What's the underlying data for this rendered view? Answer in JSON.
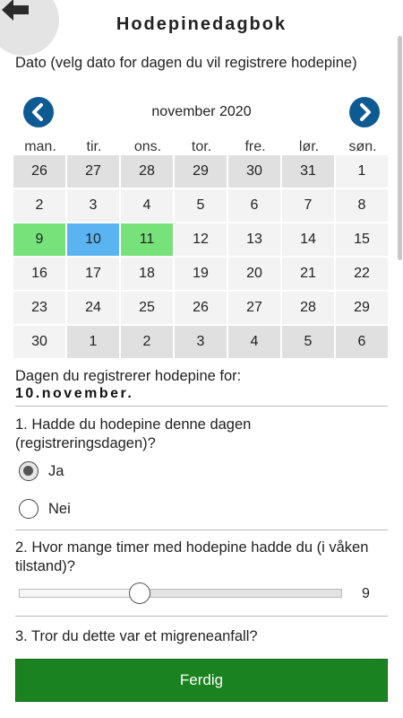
{
  "header": {
    "title": "Hodepinedagbok",
    "back_icon": "arrow-left-icon"
  },
  "date_section": {
    "label": "Dato (velg dato for dagen du vil registrere hodepine)",
    "calendar": {
      "month_title": "november 2020",
      "prev_icon": "chevron-left-icon",
      "next_icon": "chevron-right-icon",
      "weekdays": [
        "man.",
        "tir.",
        "ons.",
        "tor.",
        "fre.",
        "lør.",
        "søn."
      ],
      "weeks": [
        [
          {
            "day": "26",
            "state": "other"
          },
          {
            "day": "27",
            "state": "other"
          },
          {
            "day": "28",
            "state": "other"
          },
          {
            "day": "29",
            "state": "other"
          },
          {
            "day": "30",
            "state": "other"
          },
          {
            "day": "31",
            "state": "other"
          },
          {
            "day": "1",
            "state": "normal"
          }
        ],
        [
          {
            "day": "2",
            "state": "normal"
          },
          {
            "day": "3",
            "state": "normal"
          },
          {
            "day": "4",
            "state": "normal"
          },
          {
            "day": "5",
            "state": "normal"
          },
          {
            "day": "6",
            "state": "normal"
          },
          {
            "day": "7",
            "state": "normal"
          },
          {
            "day": "8",
            "state": "normal"
          }
        ],
        [
          {
            "day": "9",
            "state": "registered"
          },
          {
            "day": "10",
            "state": "selected"
          },
          {
            "day": "11",
            "state": "registered"
          },
          {
            "day": "12",
            "state": "normal"
          },
          {
            "day": "13",
            "state": "normal"
          },
          {
            "day": "14",
            "state": "normal"
          },
          {
            "day": "15",
            "state": "normal"
          }
        ],
        [
          {
            "day": "16",
            "state": "normal"
          },
          {
            "day": "17",
            "state": "normal"
          },
          {
            "day": "18",
            "state": "normal"
          },
          {
            "day": "19",
            "state": "normal"
          },
          {
            "day": "20",
            "state": "normal"
          },
          {
            "day": "21",
            "state": "normal"
          },
          {
            "day": "22",
            "state": "normal"
          }
        ],
        [
          {
            "day": "23",
            "state": "normal"
          },
          {
            "day": "24",
            "state": "normal"
          },
          {
            "day": "25",
            "state": "normal"
          },
          {
            "day": "26",
            "state": "normal"
          },
          {
            "day": "27",
            "state": "normal"
          },
          {
            "day": "28",
            "state": "normal"
          },
          {
            "day": "29",
            "state": "normal"
          }
        ],
        [
          {
            "day": "30",
            "state": "normal"
          },
          {
            "day": "1",
            "state": "other"
          },
          {
            "day": "2",
            "state": "other"
          },
          {
            "day": "3",
            "state": "other"
          },
          {
            "day": "4",
            "state": "other"
          },
          {
            "day": "5",
            "state": "other"
          },
          {
            "day": "6",
            "state": "other"
          }
        ]
      ],
      "colors": {
        "registered": "#78e27a",
        "selected": "#5ab4f2",
        "other_month": "#e0e0e0",
        "current_month": "#f3f3f3",
        "nav": "#0e5a92"
      }
    },
    "registering_label": "Dagen du registrerer hodepine for:",
    "registering_date": "10.november."
  },
  "q1": {
    "text": "1. Hadde du hodepine denne dagen (registreringsdagen)?",
    "options": [
      {
        "label": "Ja",
        "checked": true
      },
      {
        "label": "Nei",
        "checked": false
      }
    ]
  },
  "q2": {
    "text": "2. Hvor mange timer med hodepine hadde du (i våken tilstand)?",
    "slider": {
      "value": 9,
      "min": 0,
      "max": 24,
      "display": "9"
    }
  },
  "q3": {
    "text": "3. Tror du dette var et migreneanfall?"
  },
  "footer": {
    "done_label": "Ferdig",
    "done_color": "#1a831f"
  }
}
